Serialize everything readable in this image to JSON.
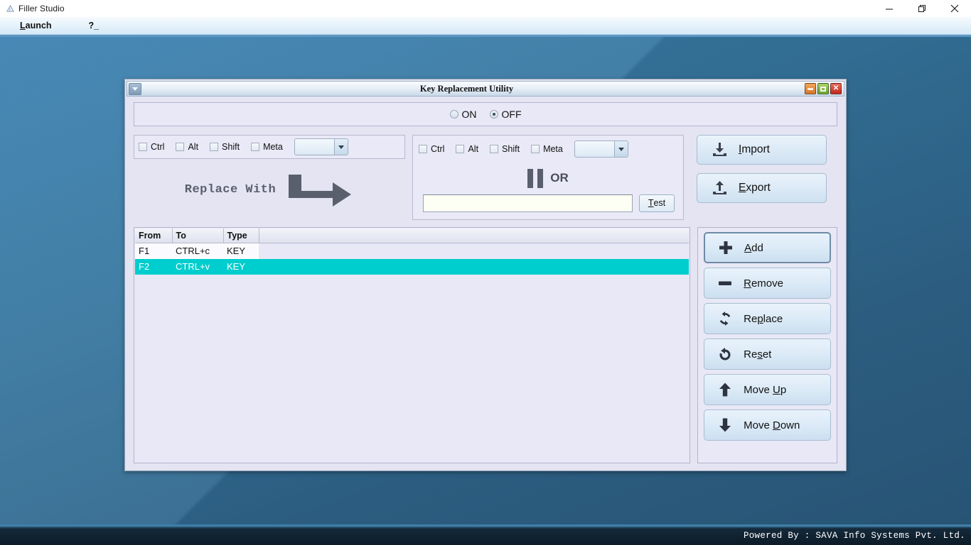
{
  "app": {
    "title": "Filler Studio",
    "icon": "app-icon",
    "window_controls": [
      {
        "name": "minimize",
        "glyph": "—"
      },
      {
        "name": "maximize",
        "glyph": "❐"
      },
      {
        "name": "close",
        "glyph": "✕"
      }
    ],
    "menu": [
      {
        "label": "Launch",
        "mnemonic": "L"
      },
      {
        "label": "?_",
        "mnemonic": ""
      }
    ]
  },
  "statusbar": {
    "text": "Powered By : SAVA Info Systems Pvt. Ltd."
  },
  "internal_window": {
    "title": "Key Replacement Utility",
    "sysmenu_icon": "chevron-down-icon",
    "buttons": [
      {
        "name": "minimize",
        "color": "#d4742a"
      },
      {
        "name": "maximize",
        "color": "#6ba32e"
      },
      {
        "name": "close",
        "color": "#c0261c",
        "glyph": "✕"
      }
    ]
  },
  "toggle": {
    "options": [
      {
        "label": "ON",
        "selected": false
      },
      {
        "label": "OFF",
        "selected": true
      }
    ]
  },
  "source": {
    "modifiers": [
      {
        "label": "Ctrl",
        "checked": false
      },
      {
        "label": "Alt",
        "checked": false
      },
      {
        "label": "Shift",
        "checked": false
      },
      {
        "label": "Meta",
        "checked": false
      }
    ],
    "key_combo": {
      "value": "",
      "placeholder": ""
    },
    "replace_label": "Replace With",
    "arrow_icon": "right-arrow-icon"
  },
  "target": {
    "modifiers": [
      {
        "label": "Ctrl",
        "checked": false
      },
      {
        "label": "Alt",
        "checked": false
      },
      {
        "label": "Shift",
        "checked": false
      },
      {
        "label": "Meta",
        "checked": false
      }
    ],
    "key_combo": {
      "value": "",
      "placeholder": ""
    },
    "or_label": "OR",
    "or_icon": "pause-bars-icon",
    "test_input": {
      "value": "",
      "placeholder": ""
    },
    "test_button": {
      "label": "Test",
      "mnemonic": "T"
    }
  },
  "io_buttons": [
    {
      "label": "Import",
      "mnemonic": "I",
      "icon": "download-icon"
    },
    {
      "label": "Export",
      "mnemonic": "E",
      "icon": "upload-icon"
    }
  ],
  "table": {
    "columns": [
      "From",
      "To",
      "Type"
    ],
    "rows": [
      {
        "from": "F1",
        "to": "CTRL+c",
        "type": "KEY",
        "selected": false
      },
      {
        "from": "F2",
        "to": "CTRL+v",
        "type": "KEY",
        "selected": true
      }
    ],
    "selection_color": "#00cdcd"
  },
  "actions": [
    {
      "label": "Add",
      "mnemonic": "A",
      "icon": "plus-icon",
      "focused": true
    },
    {
      "label": "Remove",
      "mnemonic": "R",
      "icon": "minus-icon",
      "focused": false
    },
    {
      "label": "Replace",
      "mnemonic": "p",
      "icon": "refresh-icon",
      "focused": false
    },
    {
      "label": "Reset",
      "mnemonic": "s",
      "icon": "undo-icon",
      "focused": false
    },
    {
      "label": "Move Up",
      "mnemonic": "U",
      "icon": "arrow-up-icon",
      "focused": false
    },
    {
      "label": "Move Down",
      "mnemonic": "D",
      "icon": "arrow-down-icon",
      "focused": false
    }
  ],
  "colors": {
    "desktop_top": "#3d83b4",
    "desktop_bottom": "#2a5a7d",
    "panel_bg": "#e8e8f6",
    "accent": "#00cdcd"
  }
}
